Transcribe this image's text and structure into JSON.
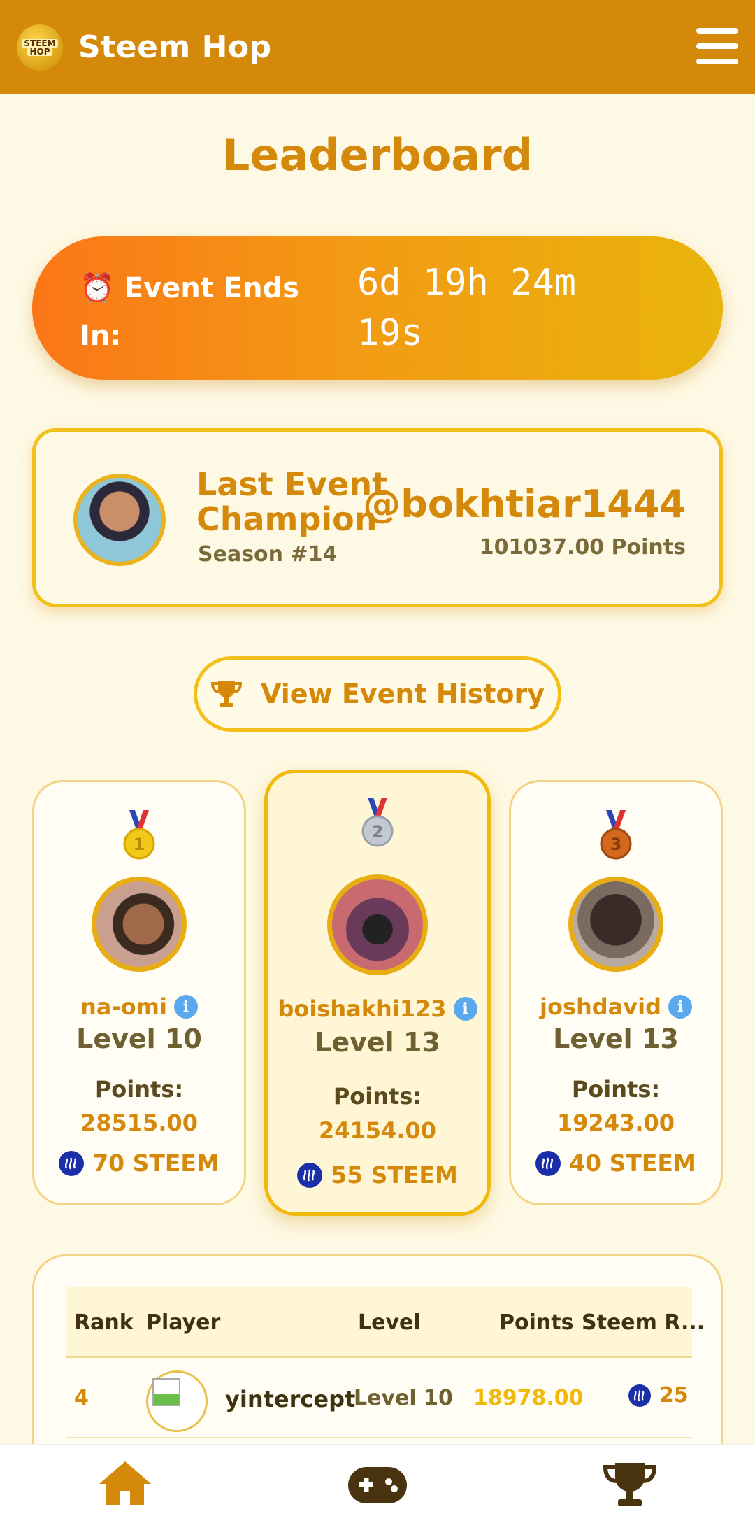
{
  "header": {
    "logo_text_1": "STEEM",
    "logo_text_2": "HOP",
    "title": "Steem Hop",
    "menu_icon": "hamburger-icon"
  },
  "page": {
    "title": "Leaderboard"
  },
  "event_timer": {
    "icon": "alarm-clock-icon",
    "icon_glyph": "⏰",
    "label": "Event Ends In:",
    "value": "6d 19h 24m 19s"
  },
  "last_champion": {
    "label": "Last Event Champion",
    "season": "Season #14",
    "username": "@bokhtiar1444",
    "points": "101037.00 Points"
  },
  "history_button": {
    "icon": "trophy-icon",
    "label": "View Event History"
  },
  "podium": [
    {
      "rank": 1,
      "medal": "gold-medal-icon",
      "medal_color": "#f2c81a",
      "medal_digit": "1",
      "username": "na-omi",
      "level": "Level 10",
      "points_label": "Points:",
      "points": "28515.00",
      "reward": "70 STEEM"
    },
    {
      "rank": 2,
      "medal": "silver-medal-icon",
      "medal_color": "#b8bcc4",
      "medal_digit": "2",
      "username": "boishakhi123",
      "level": "Level 13",
      "points_label": "Points:",
      "points": "24154.00",
      "reward": "55 STEEM"
    },
    {
      "rank": 3,
      "medal": "bronze-medal-icon",
      "medal_color": "#d2691e",
      "medal_digit": "3",
      "username": "joshdavid",
      "level": "Level 13",
      "points_label": "Points:",
      "points": "19243.00",
      "reward": "40 STEEM"
    }
  ],
  "table": {
    "headers": [
      "Rank",
      "Player",
      "Level",
      "Points",
      "Steem R..."
    ],
    "rows": [
      {
        "rank": "4",
        "player": "yintercept",
        "level": "Level 10",
        "points": "18978.00",
        "reward": "25"
      }
    ]
  },
  "bottom_nav": [
    {
      "icon": "home-icon"
    },
    {
      "icon": "gamepad-icon"
    },
    {
      "icon": "trophy-icon"
    }
  ],
  "colors": {
    "header_bg": "#d4890a",
    "accent": "#d4890a",
    "page_bg": "#fef9e4",
    "card_border": "#f2c01a",
    "steem_blue": "#1a2fa8",
    "info_blue": "#5aa8ee"
  }
}
